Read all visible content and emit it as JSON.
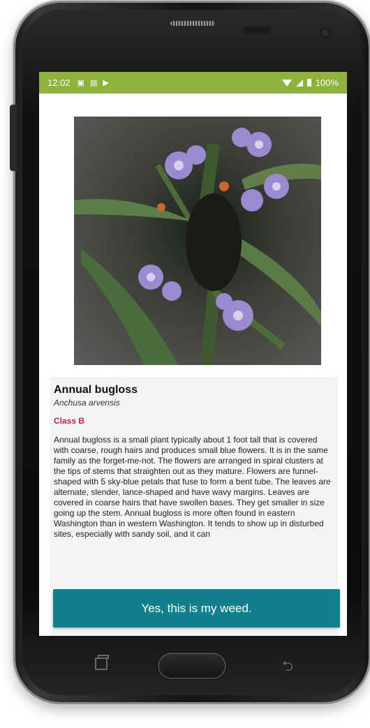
{
  "status_bar": {
    "time": "12:02",
    "icons_left": [
      "image-icon",
      "sd-card-icon",
      "play-store-icon"
    ],
    "icons_right": [
      "wifi-icon",
      "signal-icon",
      "battery-icon"
    ],
    "battery": "100%",
    "color": "#8fb23c"
  },
  "weed": {
    "common_name": "Annual bugloss",
    "latin_name": "Anchusa arvensis",
    "class": "Class B",
    "description": "Annual bugloss is a small plant typically about 1 foot tall that is covered with coarse, rough hairs and produces small blue flowers. It is in the same family as the forget-me-not. The flowers are arranged in spiral clusters at the tips of stems that straighten out as they mature. Flowers are funnel-shaped with 5 sky-blue petals that fuse to form a bent tube. The leaves are alternate, slender, lance-shaped and have wavy margins. Leaves are covered in coarse hairs that have swollen bases. They get smaller in size going up the stem. Annual bugloss is more often found in eastern Washington than in western Washington. It tends to show up in disturbed sites, especially with sandy soil, and it can"
  },
  "actions": {
    "confirm_label": "Yes, this is my weed."
  },
  "colors": {
    "accent": "#127f8d",
    "class_label": "#b4285a",
    "card": "#f4f4f4"
  }
}
